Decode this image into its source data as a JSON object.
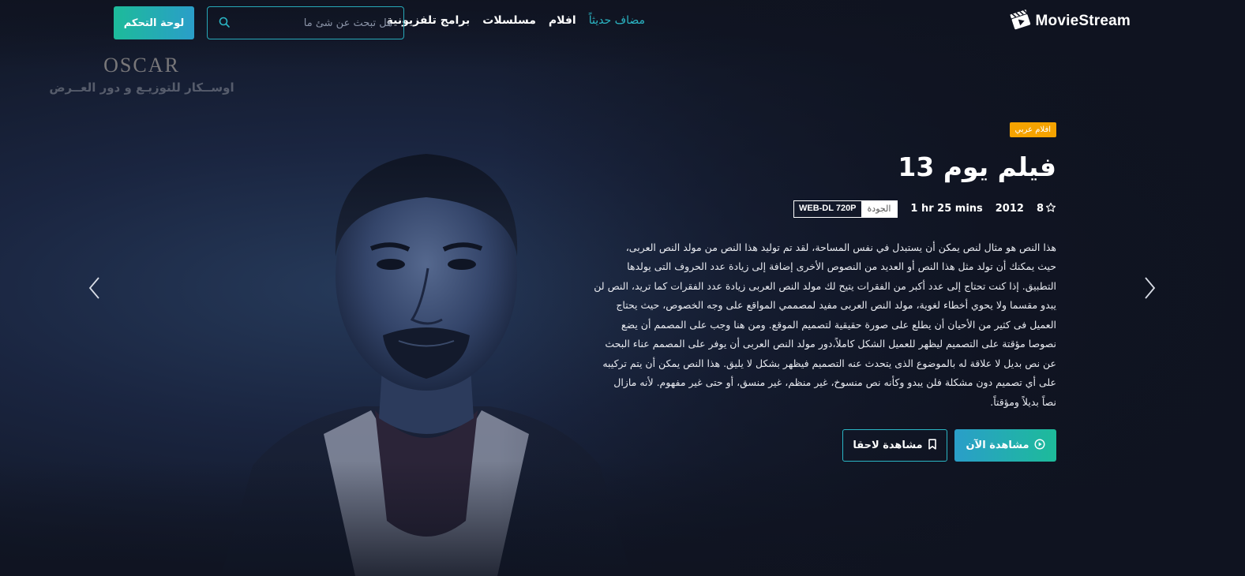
{
  "brand": {
    "name": "MovieStream"
  },
  "nav": {
    "items": [
      {
        "label": "مضاف حديثاً",
        "active": true
      },
      {
        "label": "افلام",
        "active": false
      },
      {
        "label": "مسلسلات",
        "active": false
      },
      {
        "label": "برامج تلفزيونية",
        "active": false
      }
    ]
  },
  "search": {
    "placeholder": "هل تبحث عن شئ ما",
    "value": ""
  },
  "dashboard_button": {
    "label": "لوحة التحكم"
  },
  "watermark": {
    "logo_text": "OSCAR",
    "caption": "اوســكار للتوزيـع و دور العــرض"
  },
  "movie": {
    "category_badge": "افلام عربي",
    "title": "فيلم يوم 13",
    "rating": "8",
    "year": "2012",
    "duration": "1 hr 25 mins",
    "quality_label": "الجودة",
    "quality_value": "WEB-DL 720P",
    "description_lines": [
      "هذا النص هو مثال لنص يمكن أن يستبدل في نفس المساحة، لقد تم توليد هذا النص من مولد النص العربى،",
      "حيث يمكنك أن تولد مثل هذا النص أو العديد من النصوص الأخرى إضافة إلى زيادة عدد الحروف التى يولدها",
      "التطبيق. إذا كنت تحتاج إلى عدد أكبر من الفقرات يتيح لك مولد النص العربى زيادة عدد الفقرات كما تريد، النص لن",
      "يبدو مقسما ولا يحوي أخطاء لغوية، مولد النص العربى مفيد لمصممي المواقع على وجه الخصوص، حيث يحتاج",
      "العميل فى كثير من الأحيان أن يطلع على صورة حقيقية لتصميم الموقع. ومن هنا وجب على المصمم أن يضع",
      "نصوصا مؤقتة على التصميم ليظهر للعميل الشكل كاملاً،دور مولد النص العربى أن يوفر على المصمم عناء البحث",
      "عن نص بديل لا علاقة له بالموضوع الذى يتحدث عنه التصميم فيظهر بشكل لا يليق. هذا النص يمكن أن يتم تركيبه",
      "على أي تصميم دون مشكلة فلن يبدو وكأنه نص منسوخ، غير منظم، غير منسق، أو حتى غير مفهوم. لأنه مازال",
      "نصاً بديلاً ومؤقتاً."
    ],
    "watch_now_label": "مشاهدة الآن",
    "watch_later_label": "مشاهدة لاحقا"
  },
  "colors": {
    "accent": "#2bb6c5",
    "gradient_start": "#1dbb9a",
    "gradient_end": "#2a9ec9",
    "badge": "#f5a300",
    "background": "#10131f"
  },
  "icons": {
    "logo": "clapperboard-icon",
    "search": "search-icon",
    "rating": "star-icon",
    "watch_now": "play-circle-icon",
    "watch_later": "bookmark-icon",
    "prev": "chevron-left-icon",
    "next": "chevron-right-icon"
  }
}
